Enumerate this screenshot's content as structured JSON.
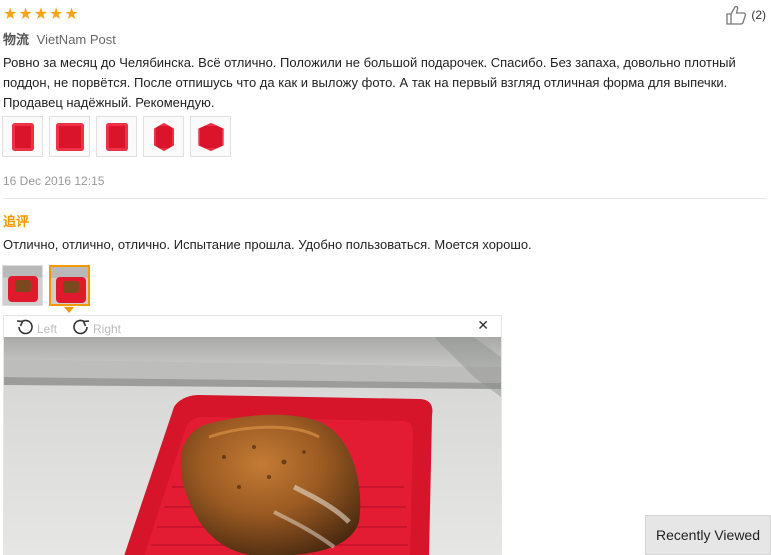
{
  "review": {
    "rating": {
      "value": 5,
      "max": 5,
      "star_glyph": "★"
    },
    "helpful": {
      "icon": "thumbs-up-icon",
      "count_label": "(2)"
    },
    "logistics_label": "物流",
    "logistics_value": "VietNam Post",
    "text": "Ровно за месяц до Челябинска. Всё отлично. Положили не большой подарочек. Спасибо. Без запаха, довольно плотный поддон, не порвётся. После отпишусь что да как и выложу фото. А так на первый взгляд отличная форма для выпечки. Продавец надёжный. Рекомендую.",
    "photo_count": 5,
    "date": "16 Dec 2016 12:15"
  },
  "followup": {
    "label": "追评",
    "text": "Отлично, отлично, отлично. Испытание прошла. Удобно пользоваться. Моется хорошо.",
    "photo_count": 2,
    "active_photo_index": 1
  },
  "viewer": {
    "rotate_left_label": "Left",
    "rotate_right_label": "Right",
    "close_glyph": "✕"
  },
  "recently_viewed_label": "Recently Viewed",
  "colors": {
    "star": "#f7a21b",
    "accent": "#f39800",
    "mold_red": "#d9142b"
  }
}
